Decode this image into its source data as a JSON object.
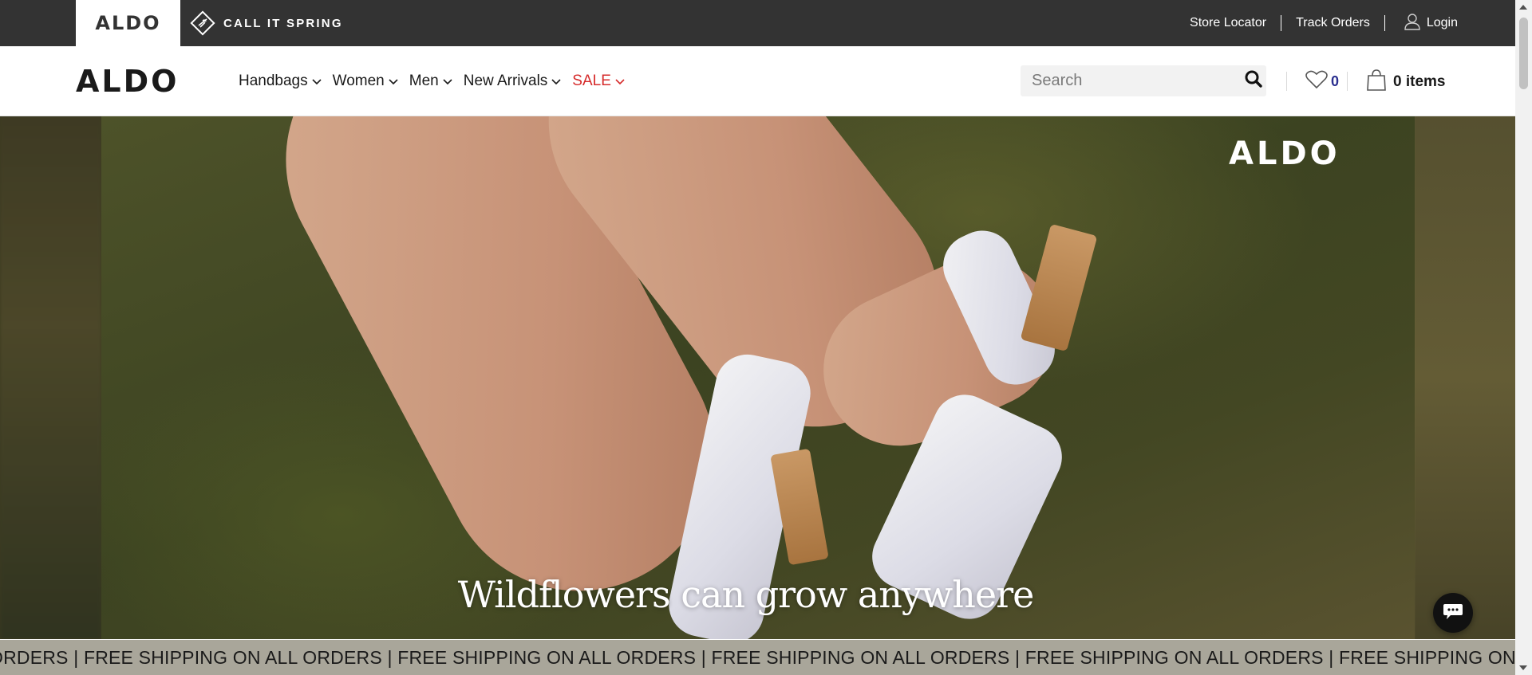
{
  "topbar": {
    "brand_tab": "ALDO",
    "call_it_spring": "CALL IT SPRING",
    "store_locator": "Store Locator",
    "track_orders": "Track Orders",
    "login": "Login"
  },
  "header": {
    "logo": "ALDO",
    "nav": [
      {
        "label": "Handbags"
      },
      {
        "label": "Women"
      },
      {
        "label": "Men"
      },
      {
        "label": "New Arrivals"
      },
      {
        "label": "SALE",
        "color": "#d62b2b"
      }
    ],
    "search": {
      "placeholder": "Search",
      "value": ""
    },
    "wishlist_count": "0",
    "cart_label": "0 items"
  },
  "hero": {
    "logo": "ALDO",
    "caption": "Wildflowers can grow anywhere"
  },
  "promo": {
    "text": "ORDERS | FREE SHIPPING ON ALL ORDERS | FREE SHIPPING ON ALL ORDERS | FREE SHIPPING ON ALL ORDERS | FREE SHIPPING ON ALL ORDERS | FREE SHIPPING ON ALL ORDERS | F"
  },
  "icons": {
    "search": "search-icon",
    "heart": "heart-icon",
    "bag": "shopping-bag-icon",
    "user": "user-icon",
    "chat": "chat-icon",
    "chevron": "chevron-down-icon"
  },
  "colors": {
    "topbar_bg": "#333333",
    "sale": "#d62b2b",
    "wishlist_count": "#2b2f8f",
    "promo_bg": "#a9a69a"
  }
}
